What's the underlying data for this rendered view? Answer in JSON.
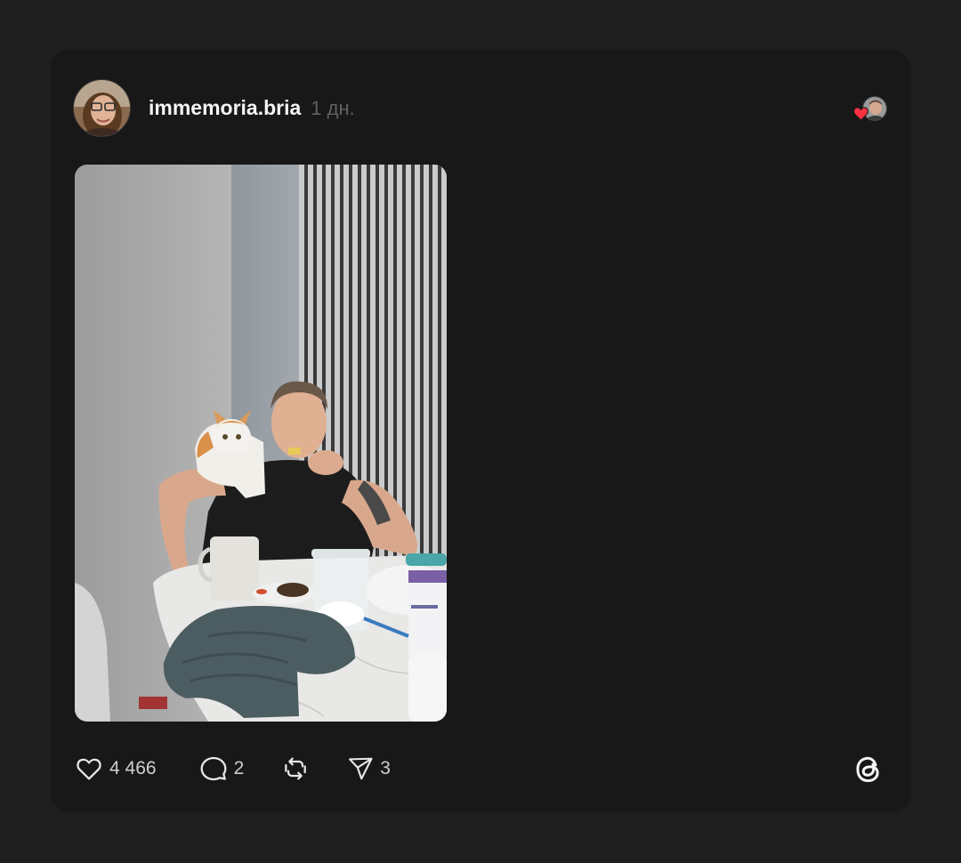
{
  "post": {
    "username": "immemoria.bria",
    "time": "1 дн."
  },
  "actions": {
    "likes": "4 466",
    "comments": "2",
    "shares": "3"
  },
  "icons": {
    "like": "heart-outline-icon",
    "comment": "speech-bubble-icon",
    "repost": "repost-arrows-icon",
    "share": "paper-plane-icon",
    "brand": "threads-logo-icon",
    "liked": "heart-filled-icon"
  },
  "colors": {
    "page_background": "#1e1e1e",
    "card_background": "#181818",
    "primary_text": "#f3f5f7",
    "secondary_text": "#616161",
    "action_text": "#cfcfcf",
    "like_red": "#ff3040"
  }
}
